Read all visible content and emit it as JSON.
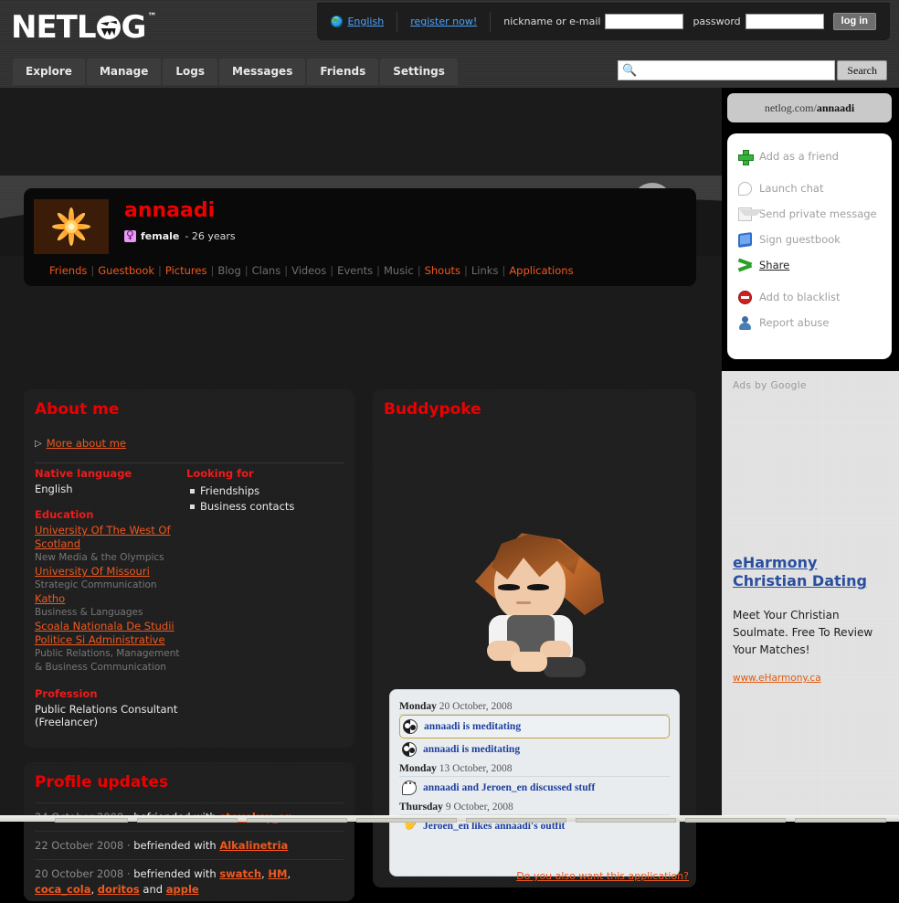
{
  "site": {
    "logo_text": "NETL",
    "logo_text2": "G",
    "logo_tm": "™"
  },
  "topbar": {
    "language": "English",
    "register": "register now!",
    "nickname_label": "nickname or e-mail",
    "nickname_value": "",
    "password_label": "password",
    "password_value": "",
    "login_button": "log in"
  },
  "nav": {
    "items": [
      "Explore",
      "Manage",
      "Logs",
      "Messages",
      "Friends",
      "Settings"
    ],
    "search_value": "",
    "search_button": "Search",
    "search_icon": "search-icon"
  },
  "profile": {
    "username": "annaadi",
    "gender": "female",
    "age": "- 26 years",
    "tabs": [
      {
        "label": "Friends",
        "active": true
      },
      {
        "label": "Guestbook",
        "active": true
      },
      {
        "label": "Pictures",
        "active": true
      },
      {
        "label": "Blog",
        "active": false
      },
      {
        "label": "Clans",
        "active": false
      },
      {
        "label": "Videos",
        "active": false
      },
      {
        "label": "Events",
        "active": false
      },
      {
        "label": "Music",
        "active": false
      },
      {
        "label": "Shouts",
        "active": true
      },
      {
        "label": "Links",
        "active": false
      },
      {
        "label": "Applications",
        "active": true
      }
    ]
  },
  "about": {
    "title": "About me",
    "more_link": "More about me",
    "native_language_label": "Native language",
    "native_language_value": "English",
    "education_label": "Education",
    "education": [
      {
        "school": "University Of The West Of Scotland",
        "field": "New Media & the Olympics"
      },
      {
        "school": "University Of Missouri",
        "field": "Strategic Communication"
      },
      {
        "school": "Katho",
        "field": "Business & Languages"
      },
      {
        "school": "Scoala Nationala De Studii Politice Si Administrative",
        "field": "Public Relations, Management & Business Communication"
      }
    ],
    "profession_label": "Profession",
    "profession_value": "Public Relations Consultant",
    "profession_note": "(Freelancer)",
    "looking_for_label": "Looking for",
    "looking_for": [
      "Friendships",
      "Business contacts"
    ]
  },
  "updates": {
    "title": "Profile updates",
    "rows": [
      {
        "date": "24 October 2008",
        "sep": "·",
        "text": "befriended with ",
        "links": [
          "stevokay_en"
        ],
        "tail": ""
      },
      {
        "date": "22 October 2008",
        "sep": "·",
        "text": "befriended with ",
        "links": [
          "Alkalinetria"
        ],
        "tail": ""
      },
      {
        "date": "20 October 2008",
        "sep": "·",
        "text": "befriended with ",
        "links": [
          "swatch",
          "HM",
          "coca_cola",
          "doritos",
          "apple"
        ],
        "tail": "and"
      }
    ]
  },
  "buddypoke": {
    "title": "Buddypoke",
    "avatar_icon": "buddypoke-avatar",
    "feed": [
      {
        "type": "date",
        "weekday": "Monday",
        "date": "20 October, 2008"
      },
      {
        "type": "item",
        "icon": "yin-yang-icon",
        "text": "annaadi is meditating",
        "highlighted": true
      },
      {
        "type": "item",
        "icon": "yin-yang-icon",
        "text": "annaadi is meditating",
        "highlighted": false
      },
      {
        "type": "date",
        "weekday": "Monday",
        "date": "13 October, 2008"
      },
      {
        "type": "item",
        "icon": "speech-bubble-icon",
        "text": "annaadi and Jeroen_en discussed stuff",
        "highlighted": false
      },
      {
        "type": "date",
        "weekday": "Thursday",
        "date": "9 October, 2008"
      },
      {
        "type": "item",
        "icon": "hand-icon",
        "text": "Jeroen_en likes annaadi's outfit",
        "highlighted": false
      }
    ],
    "want_app_link": "Do you also want this application?"
  },
  "sidebar": {
    "url_prefix": "netlog.com/",
    "url_user": "annaadi",
    "actions": [
      {
        "label": "Add as a friend",
        "icon": "plus-icon",
        "enabled": false
      },
      {
        "label": "Launch chat",
        "icon": "chat-bubble-icon",
        "enabled": false
      },
      {
        "label": "Send private message",
        "icon": "mail-icon",
        "enabled": false
      },
      {
        "label": "Sign guestbook",
        "icon": "book-icon",
        "enabled": false
      },
      {
        "label": "Share",
        "icon": "share-icon",
        "enabled": true
      },
      {
        "label": "Add to blacklist",
        "icon": "block-icon",
        "enabled": false
      },
      {
        "label": "Report abuse",
        "icon": "user-report-icon",
        "enabled": false
      }
    ],
    "ads_label": "Ads by Google",
    "ad_title": "eHarmony Christian Dating",
    "ad_body": "Meet Your Christian Soulmate. Free To Review Your Matches!",
    "ad_url": "www.eHarmony.ca"
  },
  "colors": {
    "accent_red": "#ee0000",
    "accent_orange": "#f0581e",
    "link_blue": "#4aa3ff",
    "ad_blue": "#2a4f9e"
  }
}
